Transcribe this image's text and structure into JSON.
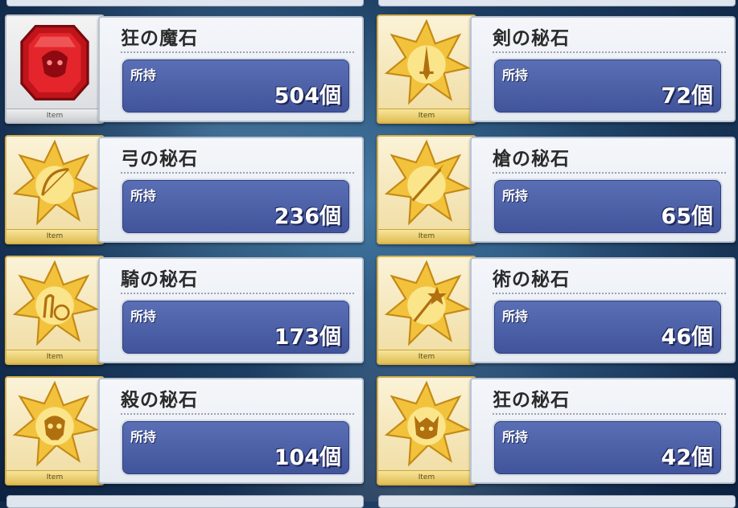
{
  "count_label": "所持",
  "item_tag": "Item",
  "cards": [
    {
      "name": "狂の魔石",
      "count": "504個",
      "icon": "berserker-gem-icon"
    },
    {
      "name": "剣の秘石",
      "count": "72個",
      "icon": "saber-gem-icon"
    },
    {
      "name": "弓の秘石",
      "count": "236個",
      "icon": "archer-gem-icon"
    },
    {
      "name": "槍の秘石",
      "count": "65個",
      "icon": "lancer-gem-icon"
    },
    {
      "name": "騎の秘石",
      "count": "173個",
      "icon": "rider-gem-icon"
    },
    {
      "name": "術の秘石",
      "count": "46個",
      "icon": "caster-gem-icon"
    },
    {
      "name": "殺の秘石",
      "count": "104個",
      "icon": "assassin-gem-icon"
    },
    {
      "name": "狂の秘石",
      "count": "42個",
      "icon": "berserker-gem-icon"
    }
  ]
}
